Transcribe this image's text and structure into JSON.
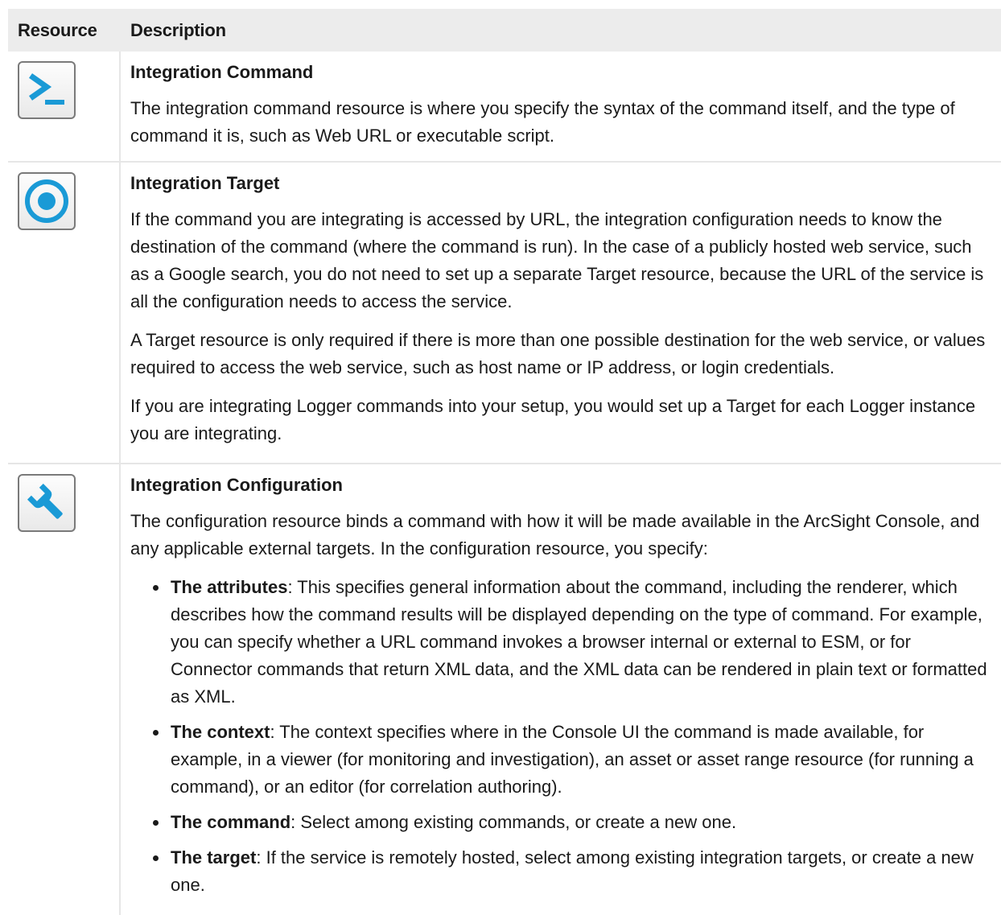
{
  "header": {
    "col_resource": "Resource",
    "col_description": "Description"
  },
  "rows": [
    {
      "icon": "terminal-icon",
      "title": "Integration Command",
      "paragraphs": [
        "The integration command resource is where you specify the syntax of the command itself, and the type of command it is, such as Web URL or executable script."
      ]
    },
    {
      "icon": "target-icon",
      "title": "Integration Target",
      "paragraphs": [
        "If the command you are integrating is accessed by URL, the integration configuration needs to know the destination of the command (where the command is run). In the case of a publicly hosted web service, such as a Google search, you do not need to set up a separate Target resource, because the URL of the service is all the configuration needs to access the service.",
        "A Target resource is only required if there is more than one possible destination for the web service, or values required to access the web service, such as host name or IP address, or login credentials.",
        "If you are integrating Logger commands into your setup, you would set up a Target for each Logger instance you are integrating."
      ]
    },
    {
      "icon": "wrench-icon",
      "title": "Integration Configuration",
      "paragraphs": [
        "The configuration resource binds a command with how it will be made available in the ArcSight Console, and any applicable external targets. In the configuration resource, you specify:"
      ],
      "bullets": [
        {
          "term": "The attributes",
          "text": ": This specifies general information about the command, including the renderer, which describes how the command results will be displayed depending on the type of command. For example, you can specify whether a URL command invokes a browser internal or external to ESM, or for Connector commands that return XML data, and the XML data can be rendered in plain text or formatted as XML."
        },
        {
          "term": "The context",
          "text": ": The context specifies where in the Console UI the command is made available, for example, in a viewer (for monitoring and investigation), an asset or asset range resource (for running a command), or an editor (for correlation authoring)."
        },
        {
          "term": "The command",
          "text": ": Select among existing commands, or create a new one."
        },
        {
          "term": "The target",
          "text": ": If the service is remotely hosted, select among existing integration targets, or create a new one."
        }
      ]
    }
  ],
  "colors": {
    "icon_accent": "#1a9ad6",
    "header_bg": "#ececec",
    "border": "#e6e6e6"
  }
}
